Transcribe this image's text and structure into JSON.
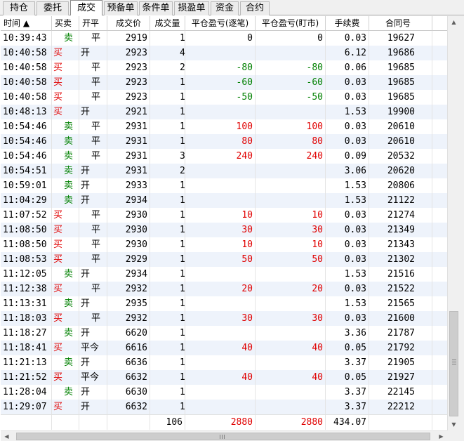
{
  "tabs": [
    {
      "label": "持仓",
      "active": false
    },
    {
      "label": "委托",
      "active": false
    },
    {
      "label": "成交",
      "active": true
    },
    {
      "label": "预备单",
      "active": false
    },
    {
      "label": "条件单",
      "active": false
    },
    {
      "label": "损盈单",
      "active": false
    },
    {
      "label": "资金",
      "active": false
    },
    {
      "label": "合约",
      "active": false
    }
  ],
  "columns": [
    "时间 ▲",
    "买卖",
    "开平",
    "成交价",
    "成交量",
    "平仓盈亏(逐笔)",
    "平仓盈亏(盯市)",
    "手续费",
    "合同号"
  ],
  "rows": [
    {
      "time": "10:39:43",
      "side": "卖",
      "oc": "平",
      "price": "2919",
      "qty": "1",
      "pnl1": "0",
      "pnl2": "0",
      "fee": "0.03",
      "id": "19627"
    },
    {
      "time": "10:40:58",
      "side": "买",
      "oc": "开",
      "price": "2923",
      "qty": "4",
      "pnl1": "",
      "pnl2": "",
      "fee": "6.12",
      "id": "19686"
    },
    {
      "time": "10:40:58",
      "side": "买",
      "oc": "平",
      "price": "2923",
      "qty": "2",
      "pnl1": "-80",
      "pnl2": "-80",
      "fee": "0.06",
      "id": "19685"
    },
    {
      "time": "10:40:58",
      "side": "买",
      "oc": "平",
      "price": "2923",
      "qty": "1",
      "pnl1": "-60",
      "pnl2": "-60",
      "fee": "0.03",
      "id": "19685"
    },
    {
      "time": "10:40:58",
      "side": "买",
      "oc": "平",
      "price": "2923",
      "qty": "1",
      "pnl1": "-50",
      "pnl2": "-50",
      "fee": "0.03",
      "id": "19685"
    },
    {
      "time": "10:48:13",
      "side": "买",
      "oc": "开",
      "price": "2921",
      "qty": "1",
      "pnl1": "",
      "pnl2": "",
      "fee": "1.53",
      "id": "19900"
    },
    {
      "time": "10:54:46",
      "side": "卖",
      "oc": "平",
      "price": "2931",
      "qty": "1",
      "pnl1": "100",
      "pnl2": "100",
      "fee": "0.03",
      "id": "20610"
    },
    {
      "time": "10:54:46",
      "side": "卖",
      "oc": "平",
      "price": "2931",
      "qty": "1",
      "pnl1": "80",
      "pnl2": "80",
      "fee": "0.03",
      "id": "20610"
    },
    {
      "time": "10:54:46",
      "side": "卖",
      "oc": "平",
      "price": "2931",
      "qty": "3",
      "pnl1": "240",
      "pnl2": "240",
      "fee": "0.09",
      "id": "20532"
    },
    {
      "time": "10:54:51",
      "side": "卖",
      "oc": "开",
      "price": "2931",
      "qty": "2",
      "pnl1": "",
      "pnl2": "",
      "fee": "3.06",
      "id": "20620"
    },
    {
      "time": "10:59:01",
      "side": "卖",
      "oc": "开",
      "price": "2933",
      "qty": "1",
      "pnl1": "",
      "pnl2": "",
      "fee": "1.53",
      "id": "20806"
    },
    {
      "time": "11:04:29",
      "side": "卖",
      "oc": "开",
      "price": "2934",
      "qty": "1",
      "pnl1": "",
      "pnl2": "",
      "fee": "1.53",
      "id": "21122"
    },
    {
      "time": "11:07:52",
      "side": "买",
      "oc": "平",
      "price": "2930",
      "qty": "1",
      "pnl1": "10",
      "pnl2": "10",
      "fee": "0.03",
      "id": "21274"
    },
    {
      "time": "11:08:50",
      "side": "买",
      "oc": "平",
      "price": "2930",
      "qty": "1",
      "pnl1": "30",
      "pnl2": "30",
      "fee": "0.03",
      "id": "21349"
    },
    {
      "time": "11:08:50",
      "side": "买",
      "oc": "平",
      "price": "2930",
      "qty": "1",
      "pnl1": "10",
      "pnl2": "10",
      "fee": "0.03",
      "id": "21343"
    },
    {
      "time": "11:08:53",
      "side": "买",
      "oc": "平",
      "price": "2929",
      "qty": "1",
      "pnl1": "50",
      "pnl2": "50",
      "fee": "0.03",
      "id": "21302"
    },
    {
      "time": "11:12:05",
      "side": "卖",
      "oc": "开",
      "price": "2934",
      "qty": "1",
      "pnl1": "",
      "pnl2": "",
      "fee": "1.53",
      "id": "21516"
    },
    {
      "time": "11:12:38",
      "side": "买",
      "oc": "平",
      "price": "2932",
      "qty": "1",
      "pnl1": "20",
      "pnl2": "20",
      "fee": "0.03",
      "id": "21522"
    },
    {
      "time": "11:13:31",
      "side": "卖",
      "oc": "开",
      "price": "2935",
      "qty": "1",
      "pnl1": "",
      "pnl2": "",
      "fee": "1.53",
      "id": "21565"
    },
    {
      "time": "11:18:03",
      "side": "买",
      "oc": "平",
      "price": "2932",
      "qty": "1",
      "pnl1": "30",
      "pnl2": "30",
      "fee": "0.03",
      "id": "21600"
    },
    {
      "time": "11:18:27",
      "side": "卖",
      "oc": "开",
      "price": "6620",
      "qty": "1",
      "pnl1": "",
      "pnl2": "",
      "fee": "3.36",
      "id": "21787"
    },
    {
      "time": "11:18:41",
      "side": "买",
      "oc": "平今",
      "price": "6616",
      "qty": "1",
      "pnl1": "40",
      "pnl2": "40",
      "fee": "0.05",
      "id": "21792"
    },
    {
      "time": "11:21:13",
      "side": "卖",
      "oc": "开",
      "price": "6636",
      "qty": "1",
      "pnl1": "",
      "pnl2": "",
      "fee": "3.37",
      "id": "21905"
    },
    {
      "time": "11:21:52",
      "side": "买",
      "oc": "平今",
      "price": "6632",
      "qty": "1",
      "pnl1": "40",
      "pnl2": "40",
      "fee": "0.05",
      "id": "21927"
    },
    {
      "time": "11:28:04",
      "side": "卖",
      "oc": "开",
      "price": "6630",
      "qty": "1",
      "pnl1": "",
      "pnl2": "",
      "fee": "3.37",
      "id": "22145"
    },
    {
      "time": "11:29:07",
      "side": "买",
      "oc": "开",
      "price": "6632",
      "qty": "1",
      "pnl1": "",
      "pnl2": "",
      "fee": "3.37",
      "id": "22212"
    }
  ],
  "total": {
    "qty": "106",
    "pnl1": "2880",
    "pnl2": "2880",
    "fee": "434.07"
  },
  "colors": {
    "buy": "#e00000",
    "sell": "#008000",
    "row_alt": "#eef3fb"
  },
  "icons": {
    "sort": "sort-ascending-icon",
    "scroll_up": "arrow-up-icon",
    "scroll_down": "arrow-down-icon",
    "scroll_left": "arrow-left-icon",
    "scroll_right": "arrow-right-icon"
  }
}
